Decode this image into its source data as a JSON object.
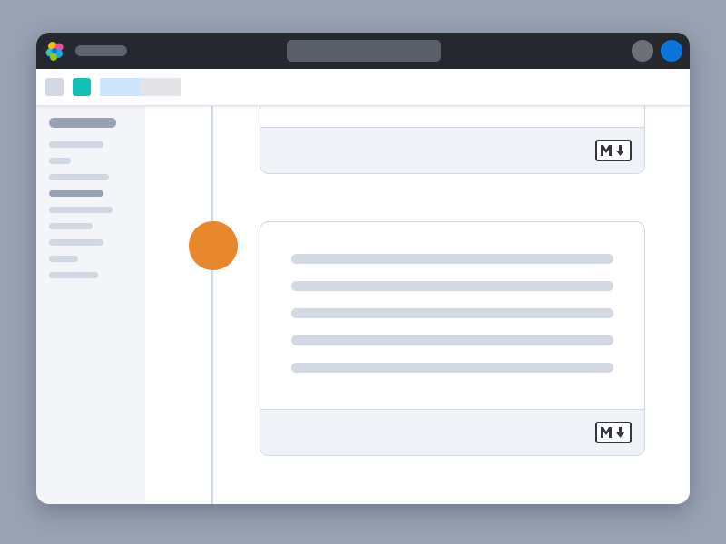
{
  "titlebar": {
    "logo": "elastic-logo-icon",
    "search": {
      "placeholder": "",
      "value": ""
    },
    "help": "help-avatar-icon",
    "user": "user-avatar-icon",
    "colors": {
      "bar": "#25282f",
      "user_avatar": "#0b76d9"
    }
  },
  "toolbar": {
    "buttons": [
      "gray-square-icon",
      "teal-square-icon"
    ],
    "tabs": [
      "tab-1",
      "tab-2"
    ]
  },
  "sidebar": {
    "item_count": 9,
    "active_index": 3
  },
  "timeline": {
    "marker_color": "#e7882f",
    "cards": [
      {
        "footer_icon": "markdown-icon"
      },
      {
        "footer_icon": "markdown-icon",
        "placeholder_lines": 5
      }
    ]
  }
}
